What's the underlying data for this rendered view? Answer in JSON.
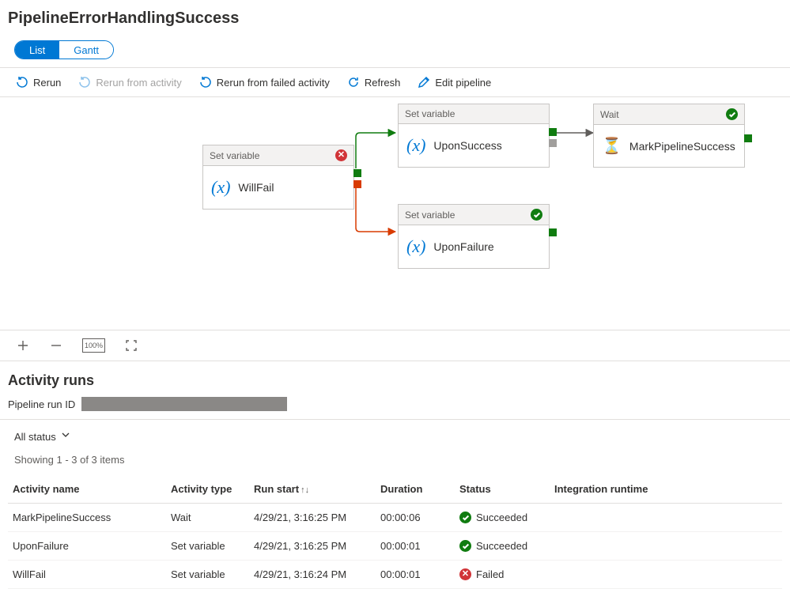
{
  "pageTitle": "PipelineErrorHandlingSuccess",
  "viewTabs": {
    "list": "List",
    "gantt": "Gantt"
  },
  "toolbar": {
    "rerun": "Rerun",
    "rerunFromActivity": "Rerun from activity",
    "rerunFromFailed": "Rerun from failed activity",
    "refresh": "Refresh",
    "editPipeline": "Edit pipeline"
  },
  "nodes": {
    "willFail": {
      "header": "Set variable",
      "label": "WillFail",
      "status": "failed"
    },
    "uponSuccess": {
      "header": "Set variable",
      "label": "UponSuccess",
      "status": "none"
    },
    "uponFailure": {
      "header": "Set variable",
      "label": "UponFailure",
      "status": "succeeded"
    },
    "markSuccess": {
      "header": "Wait",
      "label": "MarkPipelineSuccess",
      "status": "succeeded"
    }
  },
  "activityRuns": {
    "title": "Activity runs",
    "pipelineRunIdLabel": "Pipeline run ID",
    "filter": "All status",
    "countText": "Showing 1 - 3 of 3 items",
    "columns": {
      "name": "Activity name",
      "type": "Activity type",
      "start": "Run start",
      "duration": "Duration",
      "status": "Status",
      "runtime": "Integration runtime"
    },
    "rows": [
      {
        "name": "MarkPipelineSuccess",
        "type": "Wait",
        "start": "4/29/21, 3:16:25 PM",
        "duration": "00:00:06",
        "status": "Succeeded",
        "statusKind": "success",
        "runtime": ""
      },
      {
        "name": "UponFailure",
        "type": "Set variable",
        "start": "4/29/21, 3:16:25 PM",
        "duration": "00:00:01",
        "status": "Succeeded",
        "statusKind": "success",
        "runtime": ""
      },
      {
        "name": "WillFail",
        "type": "Set variable",
        "start": "4/29/21, 3:16:24 PM",
        "duration": "00:00:01",
        "status": "Failed",
        "statusKind": "fail",
        "runtime": ""
      }
    ]
  },
  "zoomLabel": "100%"
}
